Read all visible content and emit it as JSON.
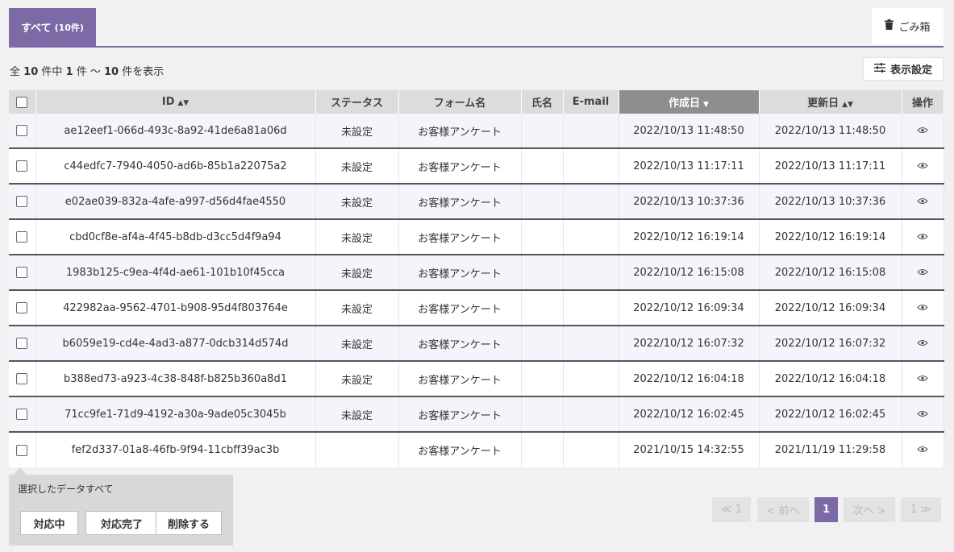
{
  "tabs": {
    "all_label": "すべて",
    "all_count": "(10件)",
    "trash_label": "ごみ箱"
  },
  "summary": {
    "prefix": "全",
    "total": "10",
    "mid1": "件中",
    "from": "1",
    "mid2": "件 〜",
    "to": "10",
    "suffix": "件を表示"
  },
  "settings_label": "表示設定",
  "columns": {
    "id": "ID",
    "status": "ステータス",
    "form": "フォーム名",
    "name": "氏名",
    "email": "E-mail",
    "created": "作成日",
    "updated": "更新日",
    "actions": "操作"
  },
  "rows": [
    {
      "id": "ae12eef1-066d-493c-8a92-41de6a81a06d",
      "status": "未設定",
      "form": "お客様アンケート",
      "name": "",
      "email": "",
      "created": "2022/10/13 11:48:50",
      "updated": "2022/10/13 11:48:50"
    },
    {
      "id": "c44edfc7-7940-4050-ad6b-85b1a22075a2",
      "status": "未設定",
      "form": "お客様アンケート",
      "name": "",
      "email": "",
      "created": "2022/10/13 11:17:11",
      "updated": "2022/10/13 11:17:11"
    },
    {
      "id": "e02ae039-832a-4afe-a997-d56d4fae4550",
      "status": "未設定",
      "form": "お客様アンケート",
      "name": "",
      "email": "",
      "created": "2022/10/13 10:37:36",
      "updated": "2022/10/13 10:37:36"
    },
    {
      "id": "cbd0cf8e-af4a-4f45-b8db-d3cc5d4f9a94",
      "status": "未設定",
      "form": "お客様アンケート",
      "name": "",
      "email": "",
      "created": "2022/10/12 16:19:14",
      "updated": "2022/10/12 16:19:14"
    },
    {
      "id": "1983b125-c9ea-4f4d-ae61-101b10f45cca",
      "status": "未設定",
      "form": "お客様アンケート",
      "name": "",
      "email": "",
      "created": "2022/10/12 16:15:08",
      "updated": "2022/10/12 16:15:08"
    },
    {
      "id": "422982aa-9562-4701-b908-95d4f803764e",
      "status": "未設定",
      "form": "お客様アンケート",
      "name": "",
      "email": "",
      "created": "2022/10/12 16:09:34",
      "updated": "2022/10/12 16:09:34"
    },
    {
      "id": "b6059e19-cd4e-4ad3-a877-0dcb314d574d",
      "status": "未設定",
      "form": "お客様アンケート",
      "name": "",
      "email": "",
      "created": "2022/10/12 16:07:32",
      "updated": "2022/10/12 16:07:32"
    },
    {
      "id": "b388ed73-a923-4c38-848f-b825b360a8d1",
      "status": "未設定",
      "form": "お客様アンケート",
      "name": "",
      "email": "",
      "created": "2022/10/12 16:04:18",
      "updated": "2022/10/12 16:04:18"
    },
    {
      "id": "71cc9fe1-71d9-4192-a30a-9ade05c3045b",
      "status": "未設定",
      "form": "お客様アンケート",
      "name": "",
      "email": "",
      "created": "2022/10/12 16:02:45",
      "updated": "2022/10/12 16:02:45"
    },
    {
      "id": "fef2d337-01a8-46fb-9f94-11cbff39ac3b",
      "status": "",
      "form": "お客様アンケート",
      "name": "",
      "email": "",
      "created": "2021/10/15 14:32:55",
      "updated": "2021/11/19 11:29:58"
    }
  ],
  "bulk": {
    "label": "選択したデータすべて",
    "in_progress": "対応中",
    "done": "対応完了",
    "delete": "削除する"
  },
  "pagination": {
    "first": "≪ 1",
    "prev": "< 前へ",
    "current": "1",
    "next": "次へ >",
    "last": "1 ≫"
  },
  "colors": {
    "accent": "#7b6aa6",
    "active_header": "#8e8e8e",
    "row_tint": "#f6f4fa"
  }
}
